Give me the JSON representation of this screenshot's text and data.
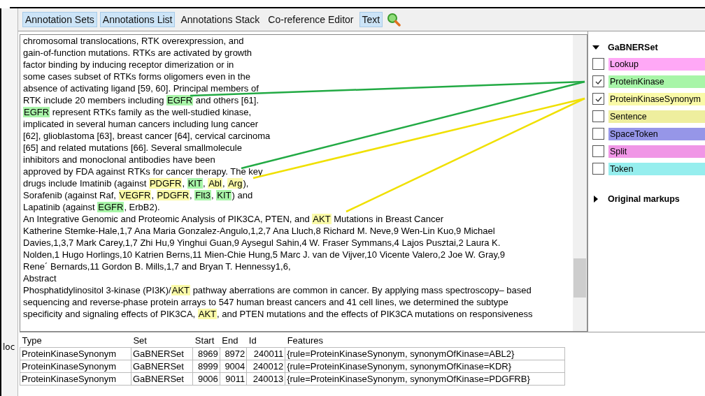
{
  "tabs": [
    {
      "label": "Annotation Sets",
      "selected": true
    },
    {
      "label": "Annotations List",
      "selected": true
    },
    {
      "label": "Annotations Stack",
      "selected": false
    },
    {
      "label": "Co-reference Editor",
      "selected": false
    },
    {
      "label": "Text",
      "selected": true
    }
  ],
  "side_label": "loc",
  "document_lines": [
    [
      {
        "text": "chromosomal translocations, RTK overexpression, and",
        "kind": "plain"
      }
    ],
    [
      {
        "text": "gain-of-function mutations. RTKs are activated by growth",
        "kind": "plain"
      }
    ],
    [
      {
        "text": "factor binding by inducing receptor dimerization or in",
        "kind": "plain"
      }
    ],
    [
      {
        "text": "some cases subset of RTKs forms oligomers even in the",
        "kind": "plain"
      }
    ],
    [
      {
        "text": "absence of activating ligand [59, 60]. Principal members of",
        "kind": "plain"
      }
    ],
    [
      {
        "text": "RTK include 20 members including ",
        "kind": "plain"
      },
      {
        "text": "EGFR",
        "kind": "kinase"
      },
      {
        "text": " and others [61].",
        "kind": "plain"
      }
    ],
    [
      {
        "text": "EGFR",
        "kind": "kinase"
      },
      {
        "text": " represent RTKs family as the well-studied kinase,",
        "kind": "plain"
      }
    ],
    [
      {
        "text": "implicated in several human cancers including lung cancer",
        "kind": "plain"
      }
    ],
    [
      {
        "text": "[62], glioblastoma [63], breast cancer [64], cervical carcinoma",
        "kind": "plain"
      }
    ],
    [
      {
        "text": "[65] and related mutations [66]. Several smallmolecule",
        "kind": "plain"
      }
    ],
    [
      {
        "text": "inhibitors and monoclonal antibodies have been",
        "kind": "plain"
      }
    ],
    [
      {
        "text": "approved by FDA against RTKs for cancer therapy. The key",
        "kind": "plain"
      }
    ],
    [
      {
        "text": "drugs include Imatinib (against ",
        "kind": "plain"
      },
      {
        "text": "PDGFR",
        "kind": "synonym"
      },
      {
        "text": ", ",
        "kind": "plain"
      },
      {
        "text": "KIT",
        "kind": "kinase"
      },
      {
        "text": ", ",
        "kind": "plain"
      },
      {
        "text": "Abl",
        "kind": "synonym"
      },
      {
        "text": ", ",
        "kind": "plain"
      },
      {
        "text": "Arg",
        "kind": "synonym"
      },
      {
        "text": "),",
        "kind": "plain"
      }
    ],
    [
      {
        "text": "Sorafenib (against Raf, ",
        "kind": "plain"
      },
      {
        "text": "VEGFR",
        "kind": "synonym"
      },
      {
        "text": ", ",
        "kind": "plain"
      },
      {
        "text": "PDGFR",
        "kind": "synonym"
      },
      {
        "text": ", ",
        "kind": "plain"
      },
      {
        "text": "Flt3",
        "kind": "kinase"
      },
      {
        "text": ", ",
        "kind": "plain"
      },
      {
        "text": "KIT",
        "kind": "kinase"
      },
      {
        "text": ") and",
        "kind": "plain"
      }
    ],
    [
      {
        "text": "Lapatinib (against ",
        "kind": "plain"
      },
      {
        "text": "EGFR",
        "kind": "kinase"
      },
      {
        "text": ", ErbB2).",
        "kind": "plain"
      }
    ],
    [
      {
        "text": "An Integrative Genomic and Proteomic Analysis of PIK3CA, PTEN, and ",
        "kind": "plain"
      },
      {
        "text": "AKT",
        "kind": "synonym"
      },
      {
        "text": " Mutations in Breast Cancer",
        "kind": "plain"
      }
    ],
    [
      {
        "text": "Katherine Stemke-Hale,1,7 Ana Maria Gonzalez-Angulo,1,2,7 Ana Lluch,8 Richard M. Neve,9 Wen-Lin Kuo,9 Michael",
        "kind": "plain"
      }
    ],
    [
      {
        "text": "Davies,1,3,7 Mark Carey,1,7 Zhi Hu,9 Yinghui Guan,9 Aysegul Sahin,4 W. Fraser Symmans,4 Lajos Pusztai,2 Laura K.",
        "kind": "plain"
      }
    ],
    [
      {
        "text": "Nolden,1 Hugo Horlings,10 Katrien Berns,11 Mien-Chie Hung,5 Marc J. van de Vijver,10 Vicente Valero,2 Joe W. Gray,9",
        "kind": "plain"
      }
    ],
    [
      {
        "text": "Rene´ Bernards,11 Gordon B. Mills,1,7 and Bryan T. Hennessy1,6,",
        "kind": "plain"
      }
    ],
    [
      {
        "text": "Abstract",
        "kind": "plain"
      }
    ],
    [
      {
        "text": "Phosphatidylinositol 3-kinase (PI3K)/",
        "kind": "plain"
      },
      {
        "text": "AKT",
        "kind": "synonym"
      },
      {
        "text": " pathway aberrations are common in cancer. By applying mass spectroscopy– based",
        "kind": "plain"
      }
    ],
    [
      {
        "text": "sequencing and reverse-phase protein arrays to 547 human breast cancers and 41 cell lines, we determined the subtype",
        "kind": "plain"
      }
    ],
    [
      {
        "text": "specificity and signaling effects of PIK3CA, ",
        "kind": "plain"
      },
      {
        "text": "AKT",
        "kind": "synonym"
      },
      {
        "text": ", and PTEN mutations and the effects of PIK3CA mutations on responsiveness",
        "kind": "plain"
      }
    ]
  ],
  "annotation_set": {
    "name": "GaBNERSet",
    "expanded": true,
    "types": [
      {
        "name": "Lookup",
        "checked": false,
        "color": "#ffa8f6"
      },
      {
        "name": "ProteinKinase",
        "checked": true,
        "color": "#a8f5a8"
      },
      {
        "name": "ProteinKinaseSynonym",
        "checked": true,
        "color": "#fafaa8"
      },
      {
        "name": "Sentence",
        "checked": false,
        "color": "#eeee9e"
      },
      {
        "name": "SpaceToken",
        "checked": false,
        "color": "#9696e8"
      },
      {
        "name": "Split",
        "checked": false,
        "color": "#f096e6"
      },
      {
        "name": "Token",
        "checked": false,
        "color": "#96eeee"
      }
    ]
  },
  "original_markups": {
    "name": "Original markups",
    "expanded": false
  },
  "table": {
    "columns": [
      "Type",
      "Set",
      "Start",
      "End",
      "Id",
      "Features"
    ],
    "rows": [
      [
        "ProteinKinaseSynonym",
        "GaBNERSet",
        "8969",
        "8972",
        "240011",
        "{rule=ProteinKinaseSynonym, synonymOfKinase=ABL2}"
      ],
      [
        "ProteinKinaseSynonym",
        "GaBNERSet",
        "8999",
        "9004",
        "240012",
        "{rule=ProteinKinaseSynonym, synonymOfKinase=KDR}"
      ],
      [
        "ProteinKinaseSynonym",
        "GaBNERSet",
        "9006",
        "9011",
        "240013",
        "{rule=ProteinKinaseSynonym, synonymOfKinase=PDGFRB}"
      ]
    ]
  }
}
